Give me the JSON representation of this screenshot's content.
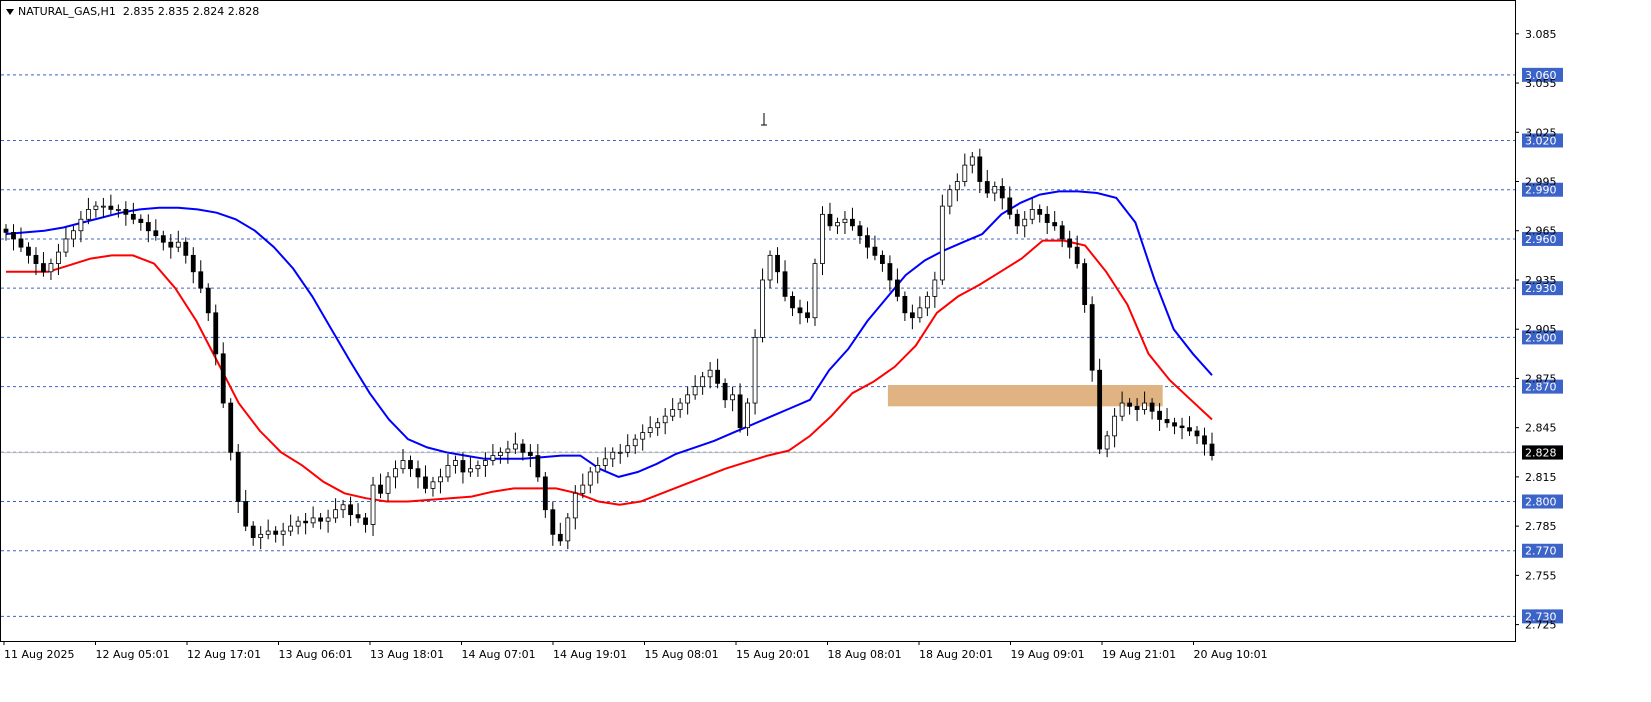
{
  "header": {
    "symbol": "NATURAL_GAS,H1",
    "ohlc": "2.835 2.835 2.824 2.828"
  },
  "colors": {
    "fast_ma": "#ff0000",
    "slow_ma": "#0000ff",
    "level_line": "#3c64c8",
    "level_label_bg": "#3c64c8",
    "zone": "#e0b382",
    "candle_up": "#ffffff",
    "candle_down": "#000000"
  },
  "chart_data": {
    "type": "candlestick",
    "ylim": [
      2.715,
      3.105
    ],
    "y_ticks": [
      "3.085",
      "3.055",
      "3.025",
      "2.995",
      "2.965",
      "2.935",
      "2.905",
      "2.875",
      "2.845",
      "2.815",
      "2.785",
      "2.755",
      "2.725"
    ],
    "x_tick_labels": [
      "11 Aug 2025",
      "12 Aug 05:01",
      "12 Aug 17:01",
      "13 Aug 06:01",
      "13 Aug 18:01",
      "14 Aug 07:01",
      "14 Aug 19:01",
      "15 Aug 08:01",
      "15 Aug 20:01",
      "18 Aug 08:01",
      "18 Aug 20:01",
      "19 Aug 09:01",
      "19 Aug 21:01",
      "20 Aug 10:01"
    ],
    "levels": [
      "3.060",
      "3.020",
      "2.990",
      "2.960",
      "2.930",
      "2.900",
      "2.870",
      "2.830",
      "2.800",
      "2.770",
      "2.730"
    ],
    "current_price": "2.828",
    "zone": {
      "from_bar": 118,
      "to_bar": 142,
      "low": 2.858,
      "high": 2.871
    },
    "close": [
      2.964,
      2.96,
      2.955,
      2.95,
      2.945,
      2.94,
      2.945,
      2.952,
      2.96,
      2.965,
      2.972,
      2.978,
      2.98,
      2.98,
      2.978,
      2.978,
      2.975,
      2.972,
      2.97,
      2.965,
      2.962,
      2.958,
      2.955,
      2.958,
      2.95,
      2.94,
      2.93,
      2.915,
      2.89,
      2.86,
      2.83,
      2.8,
      2.785,
      2.778,
      2.78,
      2.782,
      2.78,
      2.782,
      2.785,
      2.788,
      2.787,
      2.79,
      2.788,
      2.79,
      2.795,
      2.798,
      2.792,
      2.79,
      2.786,
      2.81,
      2.805,
      2.815,
      2.82,
      2.825,
      2.82,
      2.815,
      2.808,
      2.812,
      2.815,
      2.822,
      2.825,
      2.818,
      2.82,
      2.822,
      2.825,
      2.828,
      2.83,
      2.832,
      2.835,
      2.83,
      2.828,
      2.815,
      2.795,
      2.78,
      2.776,
      2.79,
      2.805,
      2.81,
      2.818,
      2.822,
      2.826,
      2.83,
      2.83,
      2.834,
      2.838,
      2.842,
      2.845,
      2.848,
      2.852,
      2.856,
      2.86,
      2.865,
      2.87,
      2.876,
      2.88,
      2.872,
      2.862,
      2.865,
      2.845,
      2.86,
      2.9,
      2.935,
      2.95,
      2.94,
      2.925,
      2.918,
      2.915,
      2.912,
      2.945,
      2.975,
      2.968,
      2.97,
      2.972,
      2.968,
      2.962,
      2.955,
      2.95,
      2.945,
      2.935,
      2.925,
      2.915,
      2.912,
      2.918,
      2.925,
      2.935,
      2.98,
      2.99,
      2.995,
      3.005,
      3.01,
      2.995,
      2.988,
      2.992,
      2.985,
      2.975,
      2.968,
      2.972,
      2.978,
      2.975,
      2.97,
      2.968,
      2.96,
      2.955,
      2.945,
      2.92,
      2.88,
      2.832,
      2.84,
      2.852,
      2.86,
      2.858,
      2.856,
      2.86,
      2.855,
      2.85,
      2.848,
      2.846,
      2.845,
      2.843,
      2.84,
      2.835,
      2.828
    ],
    "series": [
      {
        "name": "",
        "color_key": "slow_ma",
        "values": [
          2.963,
          2.964,
          2.965,
          2.967,
          2.97,
          2.973,
          2.976,
          2.978,
          2.979,
          2.979,
          2.978,
          2.976,
          2.972,
          2.965,
          2.955,
          2.942,
          2.925,
          2.905,
          2.885,
          2.866,
          2.85,
          2.838,
          2.833,
          2.83,
          2.828,
          2.826,
          2.826,
          2.826,
          2.827,
          2.828,
          2.828,
          2.82,
          2.815,
          2.818,
          2.823,
          2.829,
          2.833,
          2.837,
          2.842,
          2.847,
          2.852,
          2.857,
          2.862,
          2.88,
          2.893,
          2.91,
          2.924,
          2.938,
          2.947,
          2.953,
          2.958,
          2.963,
          2.975,
          2.982,
          2.987,
          2.989,
          2.989,
          2.988,
          2.985,
          2.97,
          2.935,
          2.905,
          2.89,
          2.877
        ]
      },
      {
        "name": "",
        "color_key": "fast_ma",
        "values": [
          2.94,
          2.94,
          2.94,
          2.944,
          2.948,
          2.95,
          2.95,
          2.945,
          2.93,
          2.91,
          2.885,
          2.86,
          2.843,
          2.83,
          2.822,
          2.812,
          2.805,
          2.802,
          2.8,
          2.8,
          2.801,
          2.802,
          2.803,
          2.806,
          2.808,
          2.808,
          2.808,
          2.805,
          2.8,
          2.798,
          2.8,
          2.805,
          2.81,
          2.815,
          2.82,
          2.824,
          2.828,
          2.831,
          2.84,
          2.852,
          2.866,
          2.873,
          2.882,
          2.895,
          2.915,
          2.925,
          2.932,
          2.94,
          2.948,
          2.959,
          2.959,
          2.956,
          2.94,
          2.92,
          2.89,
          2.874,
          2.862,
          2.85
        ]
      }
    ]
  }
}
